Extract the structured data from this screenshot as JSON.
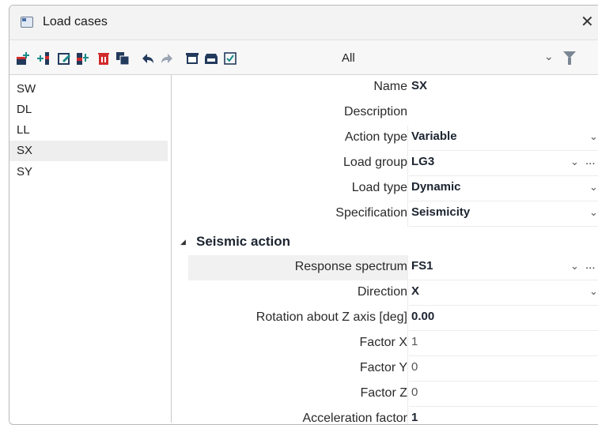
{
  "window": {
    "title": "Load cases",
    "close_glyph": "✕"
  },
  "toolbar": {
    "icons": [
      "new-icon",
      "insert-icon",
      "edit-icon",
      "copy-icon",
      "delete-icon",
      "duplicate-icon",
      "undo-icon",
      "redo-icon",
      "table-icon",
      "save-icon",
      "check-icon"
    ],
    "filter_label": "All",
    "filter_chevron": "⌄",
    "filter_icon": "funnel-icon"
  },
  "list": {
    "items": [
      "SW",
      "DL",
      "LL",
      "SX",
      "SY"
    ],
    "selected": "SX"
  },
  "properties": {
    "rows": [
      {
        "label": "Name",
        "value": "SX"
      },
      {
        "label": "Description",
        "value": ""
      },
      {
        "label": "Action type",
        "value": "Variable"
      },
      {
        "label": "Load group",
        "value": "LG3"
      },
      {
        "label": "Load type",
        "value": "Dynamic"
      },
      {
        "label": "Specification",
        "value": "Seismicity"
      }
    ],
    "section_title": "Seismic action",
    "section_rows": [
      {
        "label": "Response spectrum",
        "value": "FS1"
      },
      {
        "label": "Direction",
        "value": "X"
      },
      {
        "label": "Rotation about Z axis [deg]",
        "value": "0.00"
      },
      {
        "label": "Factor X",
        "value": "1"
      },
      {
        "label": "Factor Y",
        "value": "0"
      },
      {
        "label": "Factor Z",
        "value": "0"
      },
      {
        "label": "Acceleration factor",
        "value": "1"
      }
    ],
    "chevron": "⌄",
    "ellipsis": "..."
  },
  "colors": {
    "accent_red": "#d22b2b",
    "accent_teal": "#1a8a8a",
    "accent_navy": "#233a5c"
  }
}
